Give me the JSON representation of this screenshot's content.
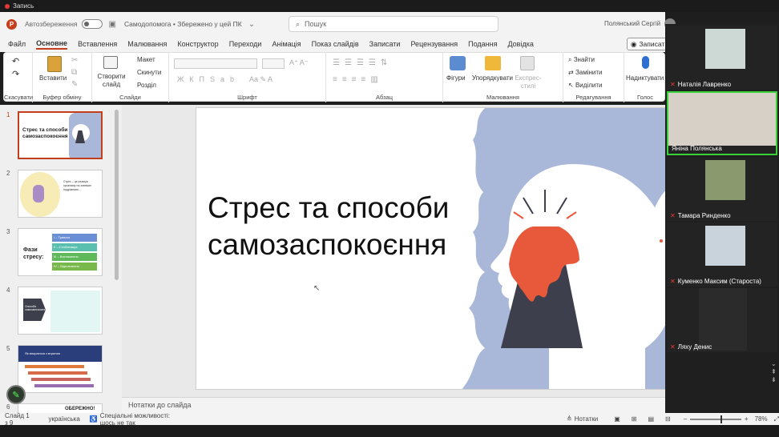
{
  "recording": {
    "label": "Запись"
  },
  "titlebar": {
    "app_icon": "P",
    "autosave": "Автозбереження",
    "doc_name": "Самодопомога • Збережено у цей ПК",
    "search_placeholder": "Пошук",
    "user_name": "Полянський Сергій"
  },
  "menu": {
    "tabs": [
      "Файл",
      "Основне",
      "Вставлення",
      "Малювання",
      "Конструктор",
      "Переходи",
      "Анімація",
      "Показ слайдів",
      "Записати",
      "Рецензування",
      "Подання",
      "Довідка"
    ],
    "active": "Основне",
    "record_button": "Записати"
  },
  "ribbon": {
    "undo_label": "Скасувати",
    "paste_label": "Вставити",
    "clipboard_label": "Буфер обміну",
    "new_slide_label": "Створити слайд",
    "layout_label": "Макет",
    "reset_label": "Скинути",
    "section_label": "Розділ",
    "slides_label": "Слайди",
    "font_label": "Шрифт",
    "paragraph_label": "Абзац",
    "shapes_label": "Фігури",
    "arrange_label": "Упорядкувати",
    "quickstyles_label": "Експрес-стилі",
    "drawing_label": "Малювання",
    "find_label": "Знайти",
    "replace_label": "Замінити",
    "select_label": "Виділити",
    "editing_label": "Редагування",
    "dictate_label": "Надиктувати",
    "voice_label": "Голос"
  },
  "thumbnails": [
    {
      "num": "1",
      "title": "Стрес та способи самозаспокоєння"
    },
    {
      "num": "2",
      "text": "Стрес – це реакція організму на зовнішні подразники..."
    },
    {
      "num": "3",
      "title": "Фази стресу:",
      "items": [
        "I – Тривога",
        "II – Стабілізація",
        "III – Виснаження",
        "IV – Відновлення"
      ]
    },
    {
      "num": "4",
      "text": "Способи самозаспокоєння"
    },
    {
      "num": "5",
      "title": "Як впоратися з втратою"
    },
    {
      "num": "6",
      "title": "ОБЕРЕЖНО!"
    }
  ],
  "slide": {
    "title_line1": "Стрес та способи",
    "title_line2": "самозаспокоєння"
  },
  "notes_placeholder": "Нотатки до слайда",
  "status": {
    "slide_count": "Слайд 1 з 9",
    "language": "українська",
    "accessibility": "Спеціальні можливості: щось не так",
    "notes_btn": "Нотатки",
    "zoom": "78%"
  },
  "participants": [
    {
      "name": "Наталія Лавренко",
      "muted": true
    },
    {
      "name": "Яніна Полянська",
      "muted": false
    },
    {
      "name": "Тамара Ринденко",
      "muted": true
    },
    {
      "name": "Куменко Максим (Староста)",
      "muted": true
    },
    {
      "name": "Ляху Денис",
      "muted": true
    }
  ],
  "colors": {
    "accent": "#c43e1c",
    "slide_blue": "#a9b7d8",
    "lava": "#e8593c",
    "mountain": "#3d3f4d"
  }
}
